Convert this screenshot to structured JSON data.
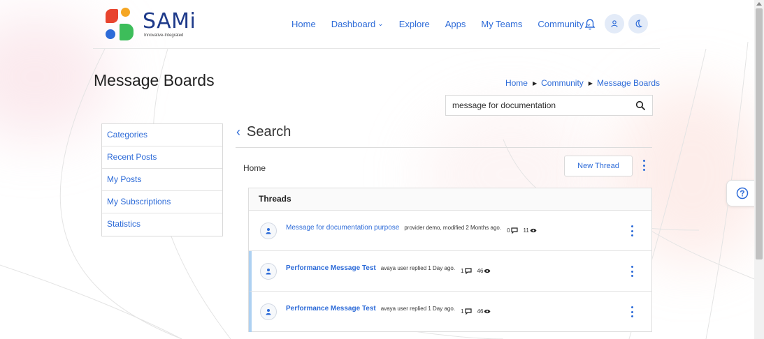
{
  "brand": {
    "name": "SAMi",
    "tagline": "Innovative-Integrated"
  },
  "nav": {
    "items": [
      {
        "label": "Home",
        "has_dropdown": false
      },
      {
        "label": "Dashboard",
        "has_dropdown": true
      },
      {
        "label": "Explore",
        "has_dropdown": false
      },
      {
        "label": "Apps",
        "has_dropdown": false
      },
      {
        "label": "My Teams",
        "has_dropdown": false
      },
      {
        "label": "Community",
        "has_dropdown": true
      }
    ],
    "icons": [
      "bell-icon",
      "user-icon",
      "moon-icon"
    ]
  },
  "page": {
    "title": "Message Boards"
  },
  "breadcrumb": [
    "Home",
    "Community",
    "Message Boards"
  ],
  "search": {
    "value": "message for documentation",
    "icon": "search-icon"
  },
  "sidebar": {
    "items": [
      "Categories",
      "Recent Posts",
      "My Posts",
      "My Subscriptions",
      "Statistics"
    ]
  },
  "main": {
    "heading": "Search",
    "location_label": "Home",
    "new_thread_label": "New Thread",
    "threads_header": "Threads",
    "threads": [
      {
        "title": "Message for documentation purpose",
        "meta": "provider demo, modified 2 Months ago.",
        "replies": "0",
        "views": "11",
        "unread": false
      },
      {
        "title": "Performance Message Test",
        "meta": "avaya user replied 1 Day ago.",
        "replies": "1",
        "views": "46",
        "unread": true
      },
      {
        "title": "Performance Message Test",
        "meta": "avaya user replied 1 Day ago.",
        "replies": "1",
        "views": "46",
        "unread": true
      }
    ]
  },
  "colors": {
    "link": "#2d6bd8",
    "unread_marker": "#aed1f2",
    "brand_navy": "#1e3a8a"
  }
}
